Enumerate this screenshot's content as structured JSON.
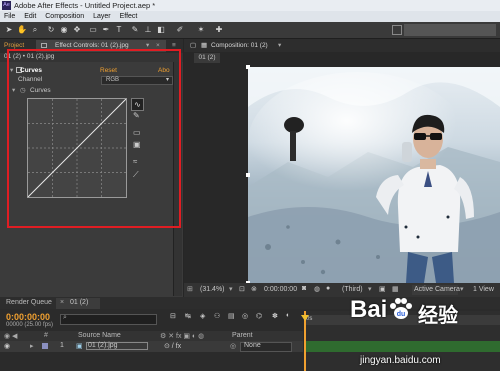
{
  "title_bar": {
    "app_logo": "Ae",
    "title": "Adobe After Effects - Untitled Project.aep *"
  },
  "menu": [
    "File",
    "Edit",
    "Composition",
    "Layer",
    "Effect"
  ],
  "left_panel": {
    "tab_project": "Project",
    "tab_effect_controls": "Effect Controls: 01 (2).jpg",
    "breadcrumb": "01 (2) • 01 (2).jpg",
    "effect_name": "Curves",
    "reset": "Reset",
    "about": "Abo",
    "channel_label": "Channel",
    "channel_value": "RGB",
    "curves_label": "Curves"
  },
  "composition": {
    "tab": "Composition: 01 (2)",
    "sub_tab": "01 (2)",
    "zoom": "(31.4%)",
    "timecode": "0:00:00:00",
    "resolution": "(Third)",
    "camera": "Active Camera",
    "view": "1 View"
  },
  "timeline": {
    "tab_render_queue": "Render Queue",
    "tab_comp": "01 (2)",
    "timecode": "0:00:00:00",
    "frame_info": "00000 (25.00 fps)",
    "col_source_name": "Source Name",
    "col_parent": "Parent",
    "layer_index": "1",
    "layer_name": "01 (2).jpg",
    "parent_value": "None",
    "ruler_mark": "0s"
  },
  "watermark": {
    "brand_text": "Bai",
    "brand_cn": "经验",
    "url": "jingyan.baidu.com"
  },
  "colors": {
    "highlight_box": "#e01d23",
    "accent_orange": "#f0a030",
    "timeline_green": "#2f6b2f"
  }
}
